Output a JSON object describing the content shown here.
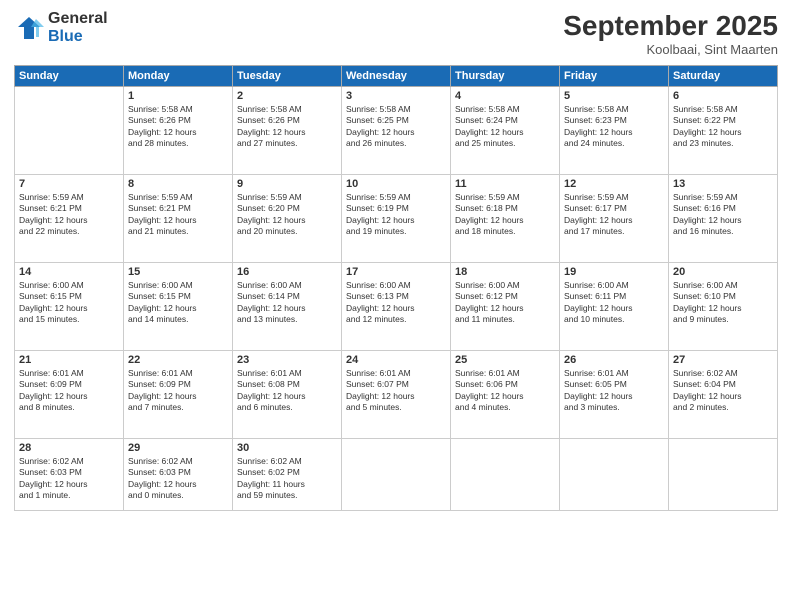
{
  "header": {
    "logo_general": "General",
    "logo_blue": "Blue",
    "month_title": "September 2025",
    "location": "Koolbaai, Sint Maarten"
  },
  "weekdays": [
    "Sunday",
    "Monday",
    "Tuesday",
    "Wednesday",
    "Thursday",
    "Friday",
    "Saturday"
  ],
  "weeks": [
    [
      {
        "day": "",
        "text": ""
      },
      {
        "day": "1",
        "text": "Sunrise: 5:58 AM\nSunset: 6:26 PM\nDaylight: 12 hours\nand 28 minutes."
      },
      {
        "day": "2",
        "text": "Sunrise: 5:58 AM\nSunset: 6:26 PM\nDaylight: 12 hours\nand 27 minutes."
      },
      {
        "day": "3",
        "text": "Sunrise: 5:58 AM\nSunset: 6:25 PM\nDaylight: 12 hours\nand 26 minutes."
      },
      {
        "day": "4",
        "text": "Sunrise: 5:58 AM\nSunset: 6:24 PM\nDaylight: 12 hours\nand 25 minutes."
      },
      {
        "day": "5",
        "text": "Sunrise: 5:58 AM\nSunset: 6:23 PM\nDaylight: 12 hours\nand 24 minutes."
      },
      {
        "day": "6",
        "text": "Sunrise: 5:58 AM\nSunset: 6:22 PM\nDaylight: 12 hours\nand 23 minutes."
      }
    ],
    [
      {
        "day": "7",
        "text": "Sunrise: 5:59 AM\nSunset: 6:21 PM\nDaylight: 12 hours\nand 22 minutes."
      },
      {
        "day": "8",
        "text": "Sunrise: 5:59 AM\nSunset: 6:21 PM\nDaylight: 12 hours\nand 21 minutes."
      },
      {
        "day": "9",
        "text": "Sunrise: 5:59 AM\nSunset: 6:20 PM\nDaylight: 12 hours\nand 20 minutes."
      },
      {
        "day": "10",
        "text": "Sunrise: 5:59 AM\nSunset: 6:19 PM\nDaylight: 12 hours\nand 19 minutes."
      },
      {
        "day": "11",
        "text": "Sunrise: 5:59 AM\nSunset: 6:18 PM\nDaylight: 12 hours\nand 18 minutes."
      },
      {
        "day": "12",
        "text": "Sunrise: 5:59 AM\nSunset: 6:17 PM\nDaylight: 12 hours\nand 17 minutes."
      },
      {
        "day": "13",
        "text": "Sunrise: 5:59 AM\nSunset: 6:16 PM\nDaylight: 12 hours\nand 16 minutes."
      }
    ],
    [
      {
        "day": "14",
        "text": "Sunrise: 6:00 AM\nSunset: 6:15 PM\nDaylight: 12 hours\nand 15 minutes."
      },
      {
        "day": "15",
        "text": "Sunrise: 6:00 AM\nSunset: 6:15 PM\nDaylight: 12 hours\nand 14 minutes."
      },
      {
        "day": "16",
        "text": "Sunrise: 6:00 AM\nSunset: 6:14 PM\nDaylight: 12 hours\nand 13 minutes."
      },
      {
        "day": "17",
        "text": "Sunrise: 6:00 AM\nSunset: 6:13 PM\nDaylight: 12 hours\nand 12 minutes."
      },
      {
        "day": "18",
        "text": "Sunrise: 6:00 AM\nSunset: 6:12 PM\nDaylight: 12 hours\nand 11 minutes."
      },
      {
        "day": "19",
        "text": "Sunrise: 6:00 AM\nSunset: 6:11 PM\nDaylight: 12 hours\nand 10 minutes."
      },
      {
        "day": "20",
        "text": "Sunrise: 6:00 AM\nSunset: 6:10 PM\nDaylight: 12 hours\nand 9 minutes."
      }
    ],
    [
      {
        "day": "21",
        "text": "Sunrise: 6:01 AM\nSunset: 6:09 PM\nDaylight: 12 hours\nand 8 minutes."
      },
      {
        "day": "22",
        "text": "Sunrise: 6:01 AM\nSunset: 6:09 PM\nDaylight: 12 hours\nand 7 minutes."
      },
      {
        "day": "23",
        "text": "Sunrise: 6:01 AM\nSunset: 6:08 PM\nDaylight: 12 hours\nand 6 minutes."
      },
      {
        "day": "24",
        "text": "Sunrise: 6:01 AM\nSunset: 6:07 PM\nDaylight: 12 hours\nand 5 minutes."
      },
      {
        "day": "25",
        "text": "Sunrise: 6:01 AM\nSunset: 6:06 PM\nDaylight: 12 hours\nand 4 minutes."
      },
      {
        "day": "26",
        "text": "Sunrise: 6:01 AM\nSunset: 6:05 PM\nDaylight: 12 hours\nand 3 minutes."
      },
      {
        "day": "27",
        "text": "Sunrise: 6:02 AM\nSunset: 6:04 PM\nDaylight: 12 hours\nand 2 minutes."
      }
    ],
    [
      {
        "day": "28",
        "text": "Sunrise: 6:02 AM\nSunset: 6:03 PM\nDaylight: 12 hours\nand 1 minute."
      },
      {
        "day": "29",
        "text": "Sunrise: 6:02 AM\nSunset: 6:03 PM\nDaylight: 12 hours\nand 0 minutes."
      },
      {
        "day": "30",
        "text": "Sunrise: 6:02 AM\nSunset: 6:02 PM\nDaylight: 11 hours\nand 59 minutes."
      },
      {
        "day": "",
        "text": ""
      },
      {
        "day": "",
        "text": ""
      },
      {
        "day": "",
        "text": ""
      },
      {
        "day": "",
        "text": ""
      }
    ]
  ]
}
